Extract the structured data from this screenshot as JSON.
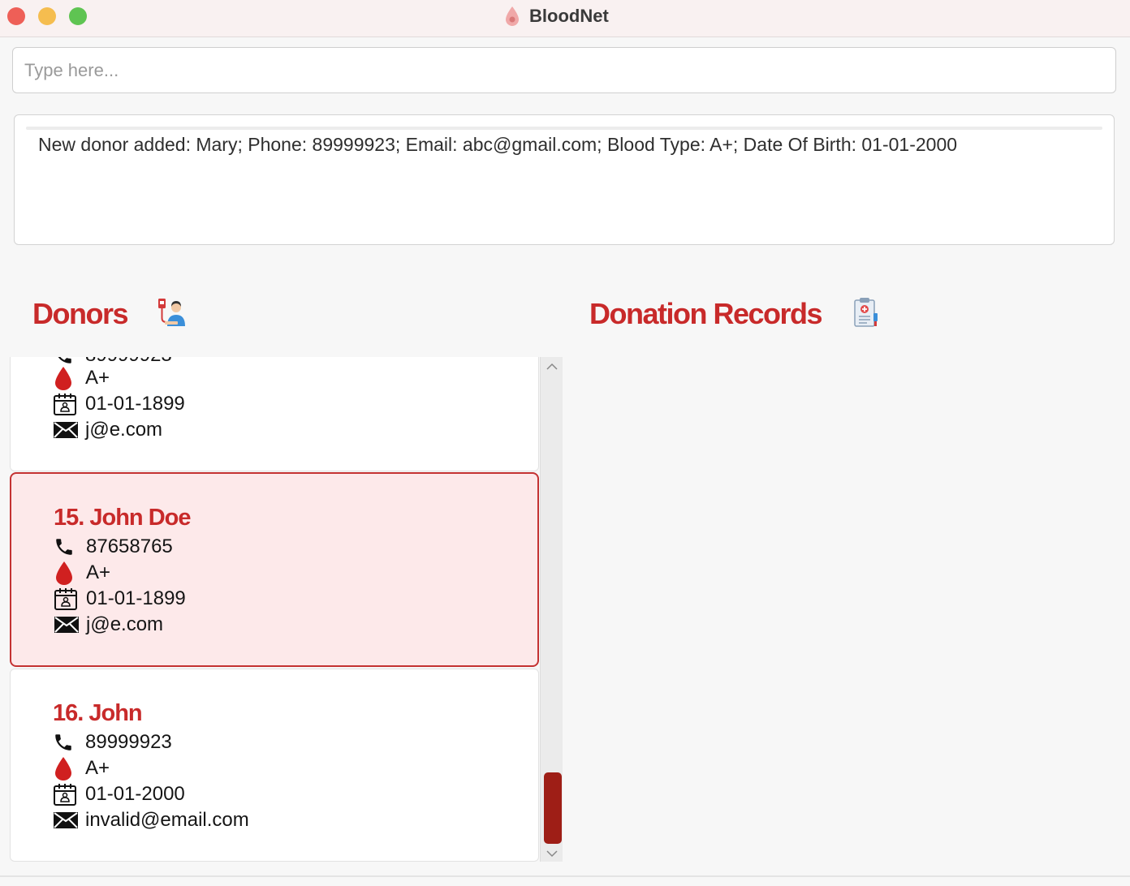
{
  "window": {
    "title": "BloodNet"
  },
  "command_box": {
    "placeholder": "Type here...",
    "value": ""
  },
  "result_display": {
    "message": "New donor added: Mary; Phone: 89999923; Email: abc@gmail.com; Blood Type: A+; Date Of Birth: 01-01-2000"
  },
  "donors_section": {
    "title": "Donors",
    "icon": "donor-icon"
  },
  "records_section": {
    "title": "Donation Records",
    "icon": "clipboard-icon"
  },
  "donors": [
    {
      "name": "",
      "phone": "89999923",
      "blood_type": "A+",
      "dob": "01-01-1899",
      "email": "j@e.com"
    },
    {
      "name": "15. John Doe",
      "phone": "87658765",
      "blood_type": "A+",
      "dob": "01-01-1899",
      "email": "j@e.com",
      "selected": true
    },
    {
      "name": "16. John",
      "phone": "89999923",
      "blood_type": "A+",
      "dob": "01-01-2000",
      "email": "invalid@email.com"
    }
  ],
  "colors": {
    "accent": "#c82a2a",
    "selected_bg": "#fde9ea",
    "scroll_thumb": "#9e1e16"
  }
}
